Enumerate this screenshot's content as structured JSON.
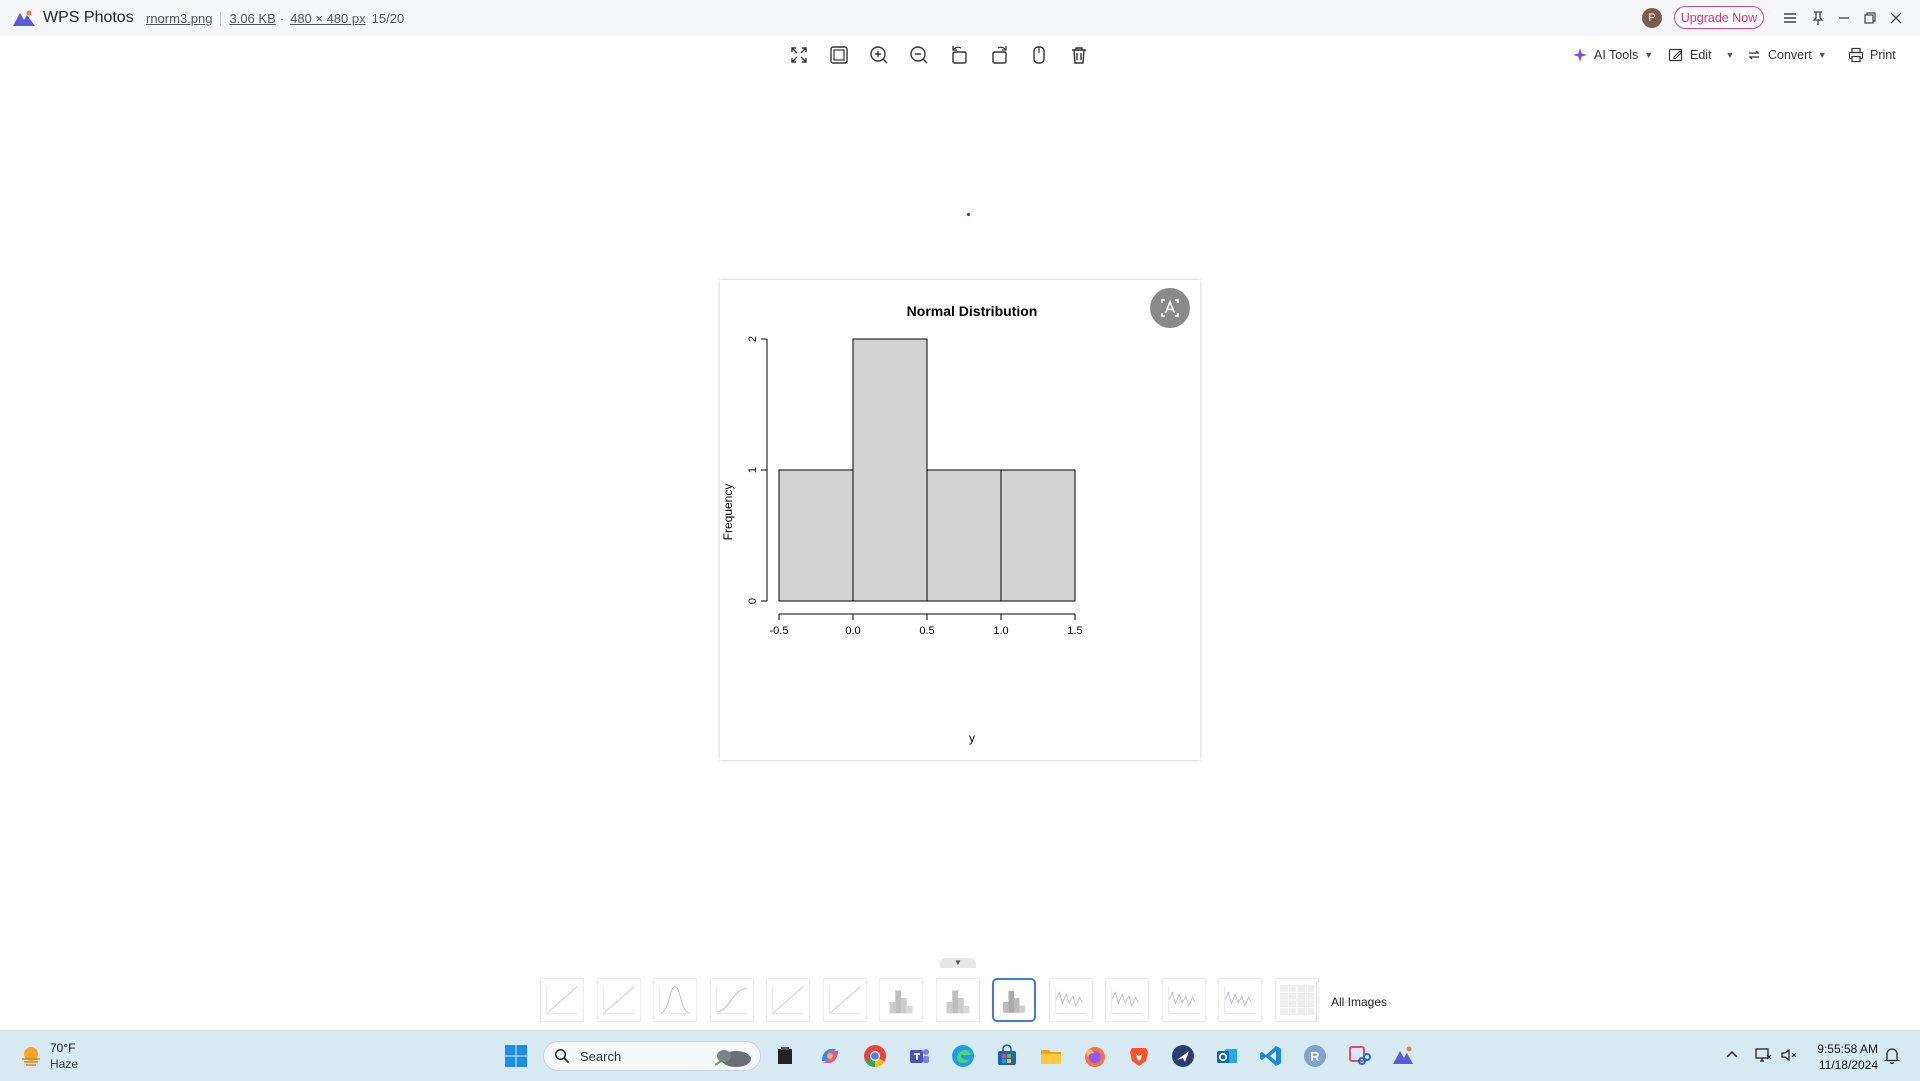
{
  "window": {
    "app_title": "WPS Photos",
    "file_name": "rnorm3.png",
    "file_size": "3.06 KB",
    "dimensions": "480 × 480 px",
    "separator": "·",
    "position": "15/20",
    "avatar_letter": "P",
    "upgrade_label": "Upgrade Now"
  },
  "toolbar": {
    "tools": [
      "fullscreen-icon",
      "fit-window-icon",
      "zoom-in-icon",
      "zoom-out-icon",
      "rotate-left-icon",
      "rotate-right-icon",
      "hand-icon",
      "delete-icon"
    ],
    "ai_tools_label": "AI Tools",
    "edit_label": "Edit",
    "convert_label": "Convert",
    "print_label": "Print"
  },
  "chart_data": {
    "type": "bar",
    "title": "Normal Distribution",
    "xlabel": "y",
    "ylabel": "Frequency",
    "bins": [
      [
        -0.5,
        0.0
      ],
      [
        0.0,
        0.5
      ],
      [
        0.5,
        1.0
      ],
      [
        1.0,
        1.5
      ]
    ],
    "values": [
      1,
      2,
      1,
      1
    ],
    "xticks": [
      -0.5,
      0.0,
      0.5,
      1.0,
      1.5
    ],
    "xtick_labels": [
      "-0.5",
      "0.0",
      "0.5",
      "1.0",
      "1.5"
    ],
    "yticks": [
      0,
      1,
      2
    ],
    "ytick_labels": [
      "0",
      "1",
      "2"
    ],
    "xlim": [
      -0.5,
      1.5
    ],
    "ylim": [
      0,
      2
    ],
    "bar_color": "#d3d3d3",
    "grid": false
  },
  "filmstrip": {
    "selected_index": 8,
    "thumbnails": [
      "line",
      "line",
      "curve",
      "sigmoid",
      "line",
      "line",
      "histogram",
      "histogram",
      "histogram",
      "wave",
      "wave",
      "wave",
      "wave",
      "grid"
    ],
    "all_images_label": "All Images"
  },
  "taskbar": {
    "weather_temp": "70°F",
    "weather_condition": "Haze",
    "search_label": "Search",
    "apps": [
      "file-explorer-icon",
      "copilot-icon",
      "chrome-icon",
      "teams-icon",
      "edge-icon",
      "store-icon",
      "folder-icon",
      "firefox-icon",
      "brave-icon",
      "vpn-icon",
      "outlook-icon",
      "vscode-icon",
      "r-icon",
      "snipping-tool-icon",
      "wps-photos-icon"
    ],
    "r_letter": "R",
    "time": "9:55:58 AM",
    "date": "11/18/2024"
  },
  "colors": {
    "accent": "#3c7be6",
    "upgrade": "#d9326f",
    "taskbar": "#d7eaf4"
  }
}
